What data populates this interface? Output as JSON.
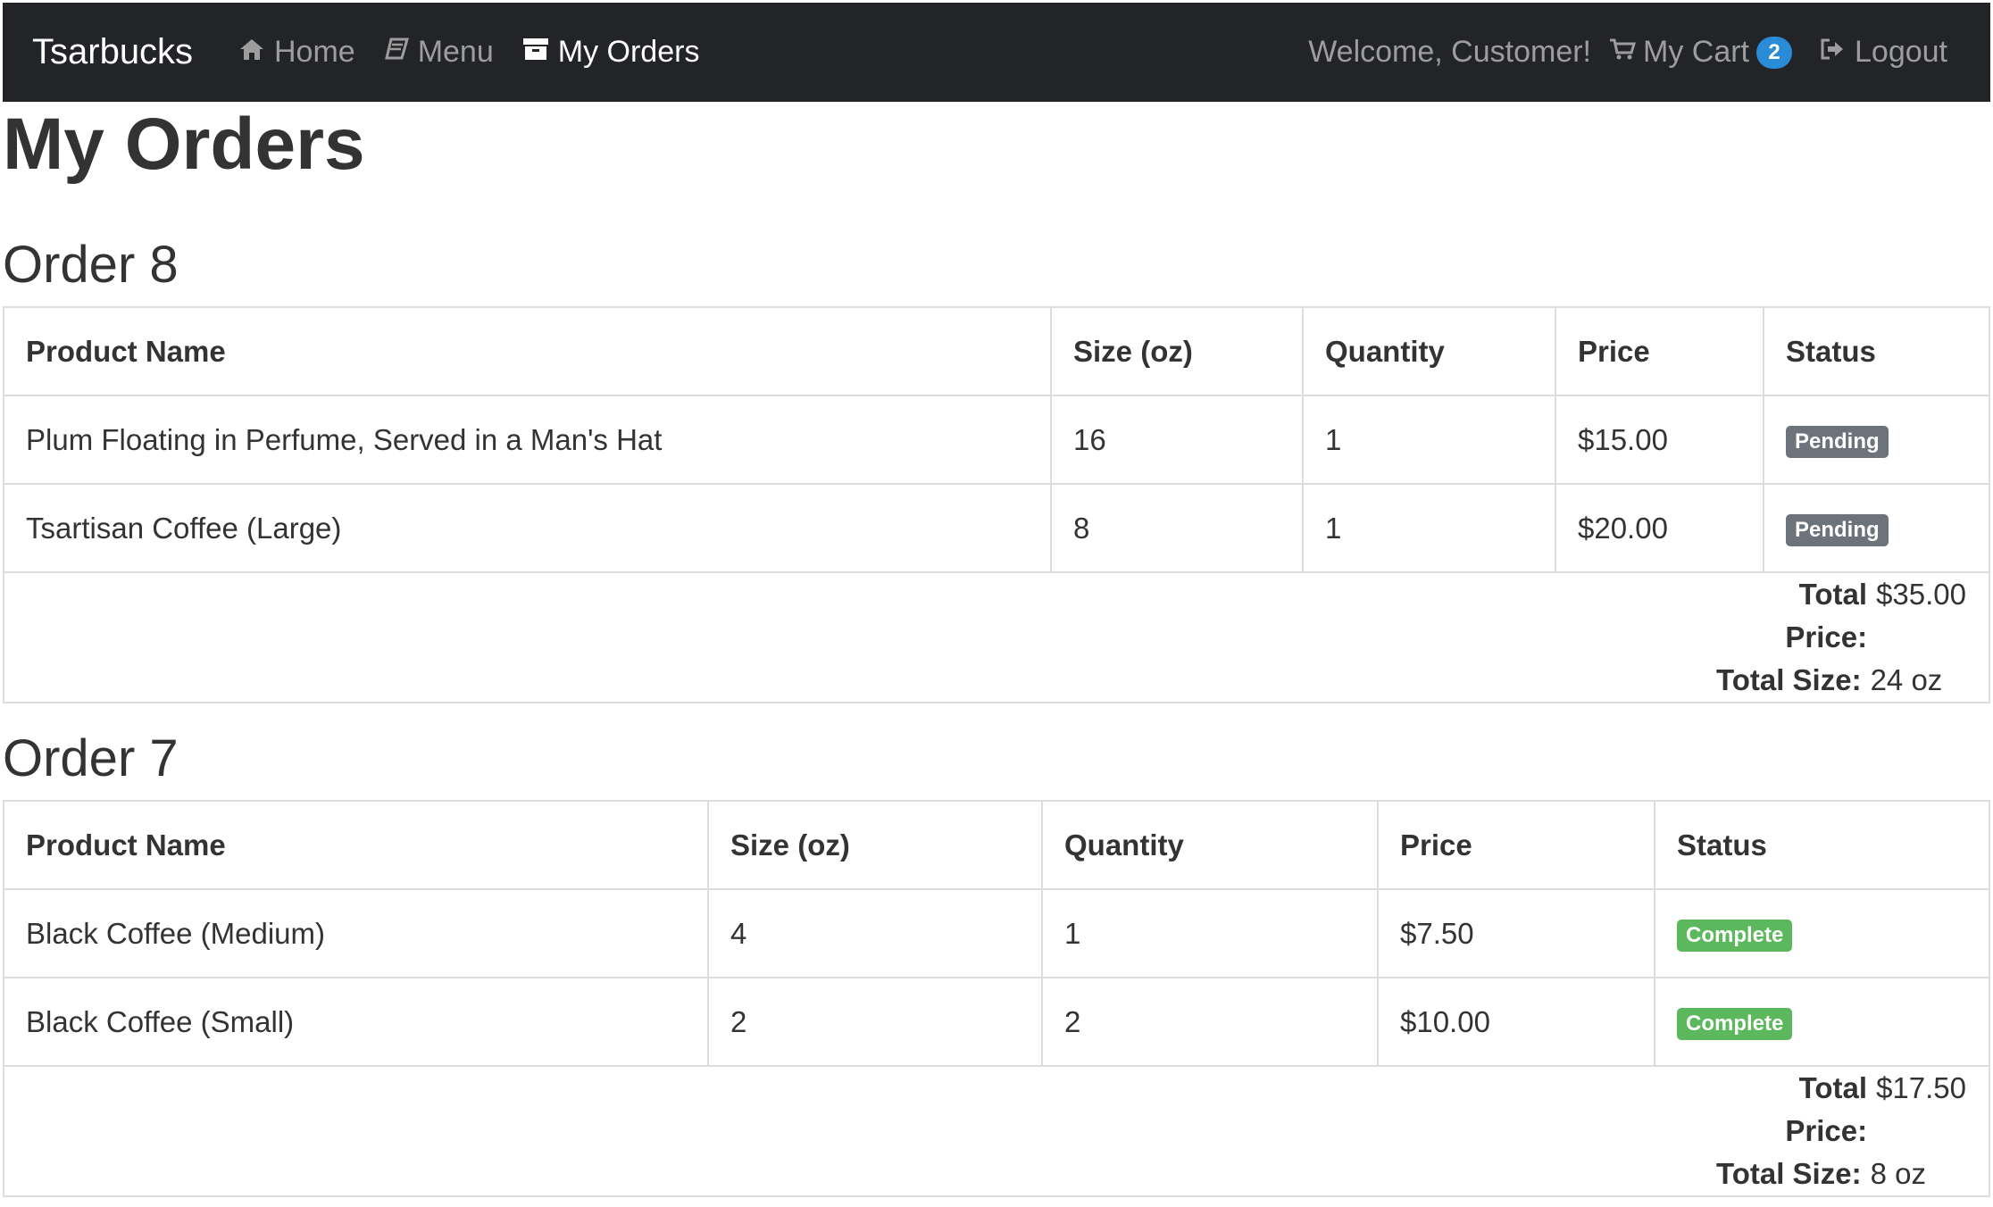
{
  "nav": {
    "brand": "Tsarbucks",
    "links": [
      {
        "label": "Home",
        "icon": "home-icon"
      },
      {
        "label": "Menu",
        "icon": "book-icon"
      },
      {
        "label": "My Orders",
        "icon": "inbox-icon"
      }
    ],
    "welcome": "Welcome, Customer!",
    "cart_label": "My Cart",
    "cart_count": "2",
    "logout_label": "Logout"
  },
  "page": {
    "title": "My Orders"
  },
  "orders": [
    {
      "title": "Order 8",
      "columns": [
        "Product Name",
        "Size (oz)",
        "Quantity",
        "Price",
        "Status"
      ],
      "rows": [
        {
          "name": "Plum Floating in Perfume, Served in a Man's Hat",
          "size": "16",
          "quantity": "1",
          "price": "$15.00",
          "status": "Pending"
        },
        {
          "name": "Tsartisan Coffee (Large)",
          "size": "8",
          "quantity": "1",
          "price": "$20.00",
          "status": "Pending"
        }
      ],
      "total_price_label": "Total Price:",
      "total_price": "$35.00",
      "total_size_label": "Total Size:",
      "total_size": "24 oz"
    },
    {
      "title": "Order 7",
      "columns": [
        "Product Name",
        "Size (oz)",
        "Quantity",
        "Price",
        "Status"
      ],
      "rows": [
        {
          "name": "Black Coffee (Medium)",
          "size": "4",
          "quantity": "1",
          "price": "$7.50",
          "status": "Complete"
        },
        {
          "name": "Black Coffee (Small)",
          "size": "2",
          "quantity": "2",
          "price": "$10.00",
          "status": "Complete"
        }
      ],
      "total_price_label": "Total Price:",
      "total_price": "$17.50",
      "total_size_label": "Total Size:",
      "total_size": "8 oz"
    }
  ],
  "colors": {
    "navbar_bg": "#222427",
    "pending": "#6c737a",
    "complete": "#5cb85c",
    "cart_badge": "#2a8bd6"
  }
}
